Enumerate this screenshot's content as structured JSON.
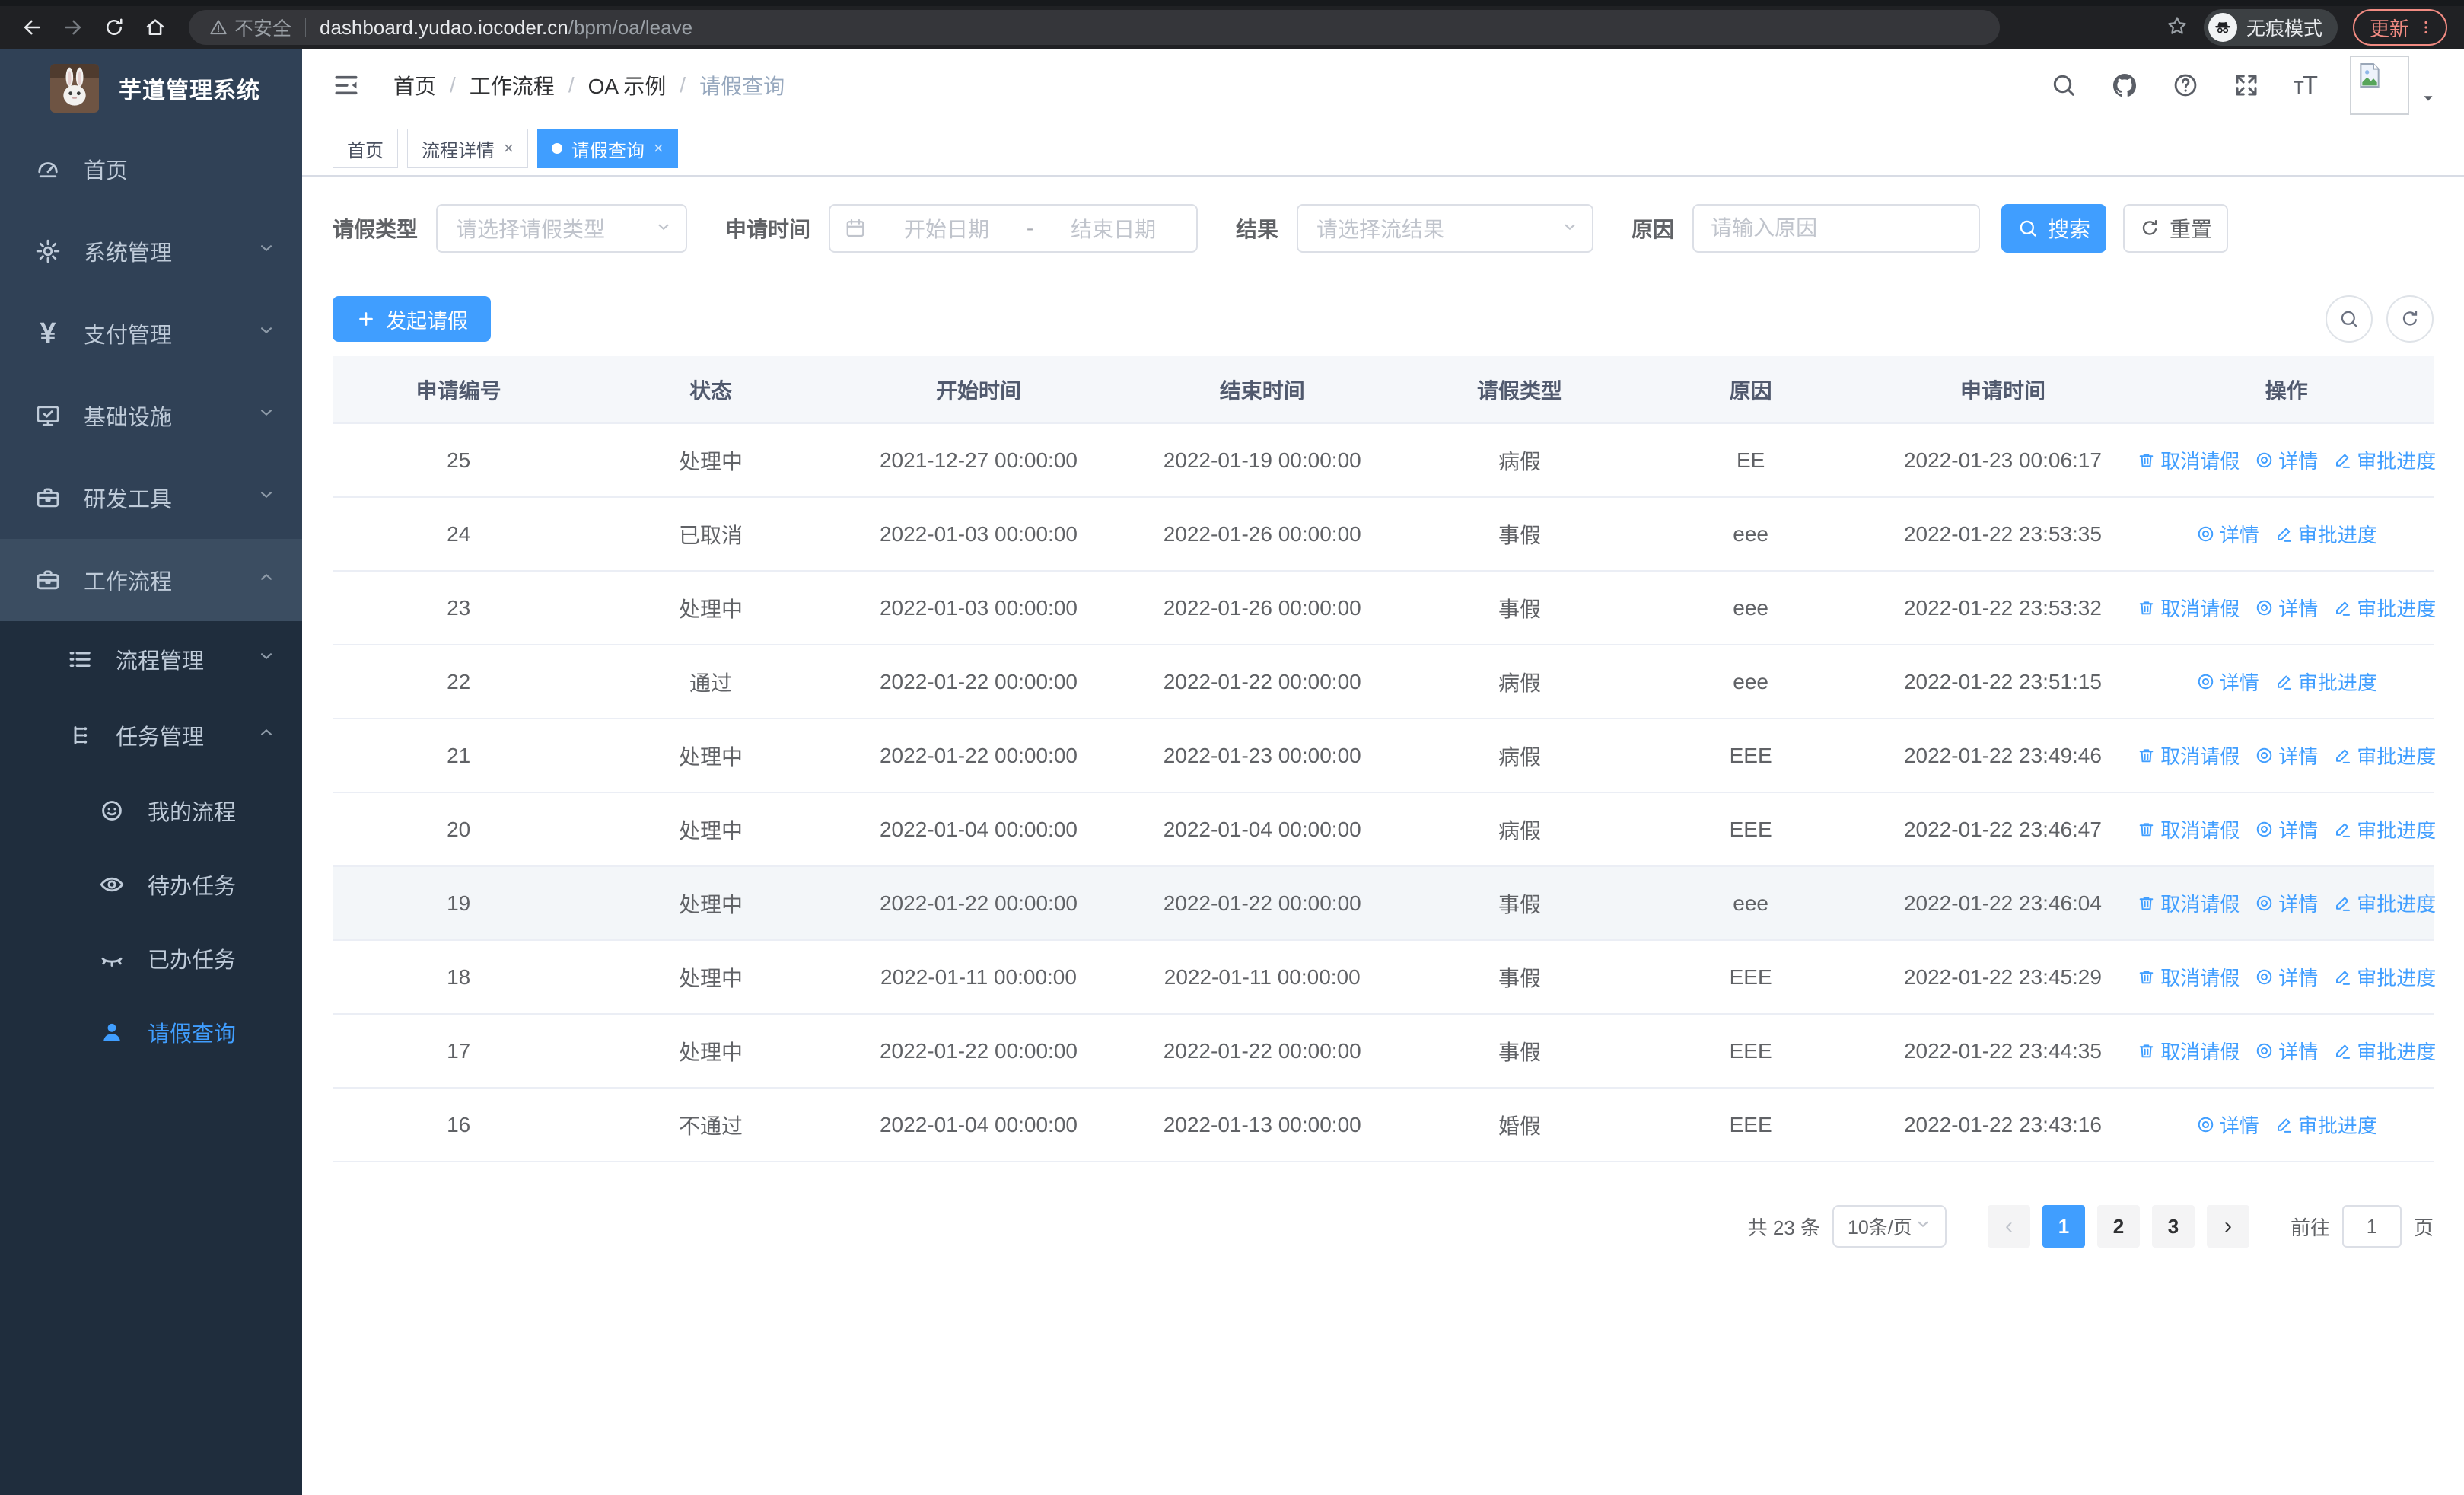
{
  "browser": {
    "security_label": "不安全",
    "url_host": "dashboard.yudao.iocoder.cn",
    "url_path": "/bpm/oa/leave",
    "incognito_label": "无痕模式",
    "update_label": "更新"
  },
  "colors": {
    "accent": "#409eff",
    "sidebar_bg": "#304156",
    "submenu_bg": "#1f2d3d",
    "header_bg": "#f5f7fa",
    "danger_update": "#f28b82"
  },
  "sidebar": {
    "app_title": "芋道管理系统",
    "items": [
      {
        "id": "home",
        "label": "首页",
        "icon": "gauge",
        "level": 1
      },
      {
        "id": "system-mgmt",
        "label": "系统管理",
        "icon": "gear",
        "level": 1,
        "chevron": "down"
      },
      {
        "id": "payment-mgmt",
        "label": "支付管理",
        "icon": "yen",
        "level": 1,
        "chevron": "down"
      },
      {
        "id": "infrastructure",
        "label": "基础设施",
        "icon": "monitor",
        "level": 1,
        "chevron": "down"
      },
      {
        "id": "dev-tools",
        "label": "研发工具",
        "icon": "briefcase",
        "level": 1,
        "chevron": "down"
      },
      {
        "id": "workflow",
        "label": "工作流程",
        "icon": "briefcase",
        "level": 1,
        "chevron": "up",
        "open": true
      },
      {
        "id": "process-mgmt",
        "label": "流程管理",
        "icon": "listflow",
        "level": 2,
        "chevron": "down"
      },
      {
        "id": "task-mgmt",
        "label": "任务管理",
        "icon": "taskflow",
        "level": 2,
        "chevron": "up"
      },
      {
        "id": "my-process",
        "label": "我的流程",
        "icon": "face",
        "level": 3
      },
      {
        "id": "todo-tasks",
        "label": "待办任务",
        "icon": "eye",
        "level": 3
      },
      {
        "id": "done-tasks",
        "label": "已办任务",
        "icon": "eyeclosed",
        "level": 3
      },
      {
        "id": "leave-query",
        "label": "请假查询",
        "icon": "person",
        "level": 3,
        "active": true
      }
    ]
  },
  "breadcrumb": [
    "首页",
    "工作流程",
    "OA 示例",
    "请假查询"
  ],
  "tabs": [
    {
      "id": "home",
      "label": "首页",
      "closable": false,
      "active": false
    },
    {
      "id": "process-detail",
      "label": "流程详情",
      "closable": true,
      "active": false
    },
    {
      "id": "leave-query",
      "label": "请假查询",
      "closable": true,
      "active": true
    }
  ],
  "filters": {
    "leave_type_label": "请假类型",
    "leave_type_placeholder": "请选择请假类型",
    "apply_time_label": "申请时间",
    "start_date_placeholder": "开始日期",
    "range_separator": "-",
    "end_date_placeholder": "结束日期",
    "result_label": "结果",
    "result_placeholder": "请选择流结果",
    "reason_label": "原因",
    "reason_placeholder": "请输入原因",
    "search_label": "搜索",
    "reset_label": "重置"
  },
  "toolbar": {
    "create_label": "发起请假"
  },
  "table": {
    "columns": [
      "申请编号",
      "状态",
      "开始时间",
      "结束时间",
      "请假类型",
      "原因",
      "申请时间",
      "操作"
    ],
    "action_labels": {
      "cancel": "取消请假",
      "detail": "详情",
      "progress": "审批进度"
    },
    "rows": [
      {
        "id": "25",
        "status": "处理中",
        "start": "2021-12-27 00:00:00",
        "end": "2022-01-19 00:00:00",
        "type": "病假",
        "reason": "EE",
        "applied": "2022-01-23 00:06:17",
        "actions": [
          "cancel",
          "detail",
          "progress"
        ],
        "highlight": false
      },
      {
        "id": "24",
        "status": "已取消",
        "start": "2022-01-03 00:00:00",
        "end": "2022-01-26 00:00:00",
        "type": "事假",
        "reason": "eee",
        "applied": "2022-01-22 23:53:35",
        "actions": [
          "detail",
          "progress"
        ],
        "highlight": false
      },
      {
        "id": "23",
        "status": "处理中",
        "start": "2022-01-03 00:00:00",
        "end": "2022-01-26 00:00:00",
        "type": "事假",
        "reason": "eee",
        "applied": "2022-01-22 23:53:32",
        "actions": [
          "cancel",
          "detail",
          "progress"
        ],
        "highlight": false
      },
      {
        "id": "22",
        "status": "通过",
        "start": "2022-01-22 00:00:00",
        "end": "2022-01-22 00:00:00",
        "type": "病假",
        "reason": "eee",
        "applied": "2022-01-22 23:51:15",
        "actions": [
          "detail",
          "progress"
        ],
        "highlight": false
      },
      {
        "id": "21",
        "status": "处理中",
        "start": "2022-01-22 00:00:00",
        "end": "2022-01-23 00:00:00",
        "type": "病假",
        "reason": "EEE",
        "applied": "2022-01-22 23:49:46",
        "actions": [
          "cancel",
          "detail",
          "progress"
        ],
        "highlight": false
      },
      {
        "id": "20",
        "status": "处理中",
        "start": "2022-01-04 00:00:00",
        "end": "2022-01-04 00:00:00",
        "type": "病假",
        "reason": "EEE",
        "applied": "2022-01-22 23:46:47",
        "actions": [
          "cancel",
          "detail",
          "progress"
        ],
        "highlight": false
      },
      {
        "id": "19",
        "status": "处理中",
        "start": "2022-01-22 00:00:00",
        "end": "2022-01-22 00:00:00",
        "type": "事假",
        "reason": "eee",
        "applied": "2022-01-22 23:46:04",
        "actions": [
          "cancel",
          "detail",
          "progress"
        ],
        "highlight": true
      },
      {
        "id": "18",
        "status": "处理中",
        "start": "2022-01-11 00:00:00",
        "end": "2022-01-11 00:00:00",
        "type": "事假",
        "reason": "EEE",
        "applied": "2022-01-22 23:45:29",
        "actions": [
          "cancel",
          "detail",
          "progress"
        ],
        "highlight": false
      },
      {
        "id": "17",
        "status": "处理中",
        "start": "2022-01-22 00:00:00",
        "end": "2022-01-22 00:00:00",
        "type": "事假",
        "reason": "EEE",
        "applied": "2022-01-22 23:44:35",
        "actions": [
          "cancel",
          "detail",
          "progress"
        ],
        "highlight": false
      },
      {
        "id": "16",
        "status": "不通过",
        "start": "2022-01-04 00:00:00",
        "end": "2022-01-13 00:00:00",
        "type": "婚假",
        "reason": "EEE",
        "applied": "2022-01-22 23:43:16",
        "actions": [
          "detail",
          "progress"
        ],
        "highlight": false
      }
    ]
  },
  "pagination": {
    "total_label": "共 23 条",
    "page_size_label": "10条/页",
    "pages": [
      "1",
      "2",
      "3"
    ],
    "active_page": "1",
    "goto_label": "前往",
    "goto_value": "1",
    "page_suffix_label": "页"
  }
}
